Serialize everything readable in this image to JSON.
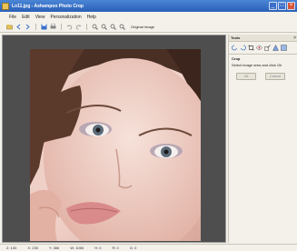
{
  "window": {
    "title": "Lo11.jpg - Ashampoo Photo Crop"
  },
  "menu": {
    "items": [
      "File",
      "Edit",
      "View",
      "Personalization",
      "Help"
    ]
  },
  "toolbar": {
    "icons": [
      "open-icon",
      "back-icon",
      "forward-icon",
      "save-icon",
      "print-icon",
      "undo-icon",
      "redo-icon",
      "zoom-in-icon",
      "zoom-out-icon",
      "zoom-fit-icon",
      "zoom-actual-icon"
    ],
    "original_label": "Original Image"
  },
  "panel": {
    "title": "Tools",
    "close": "×",
    "tool_icons": [
      "rotate-left-icon",
      "rotate-right-icon",
      "crop-icon",
      "red-eye-icon",
      "resize-icon",
      "sharpen-icon",
      "effects-icon"
    ],
    "crop_title": "Crop",
    "crop_hint": "Select image area and click Ok",
    "ok_label": "Ok",
    "cancel_label": "Cancel"
  },
  "status": {
    "cells": [
      "Z: 100",
      "X: 235",
      "Y: 366",
      "W: 1065",
      "H: 0",
      "R: 0",
      "G: 0"
    ]
  },
  "colors": {
    "titlebar": "#2a5fb8",
    "canvas_bg": "#4e4e4e",
    "panel_bg": "#f3f1ea"
  }
}
